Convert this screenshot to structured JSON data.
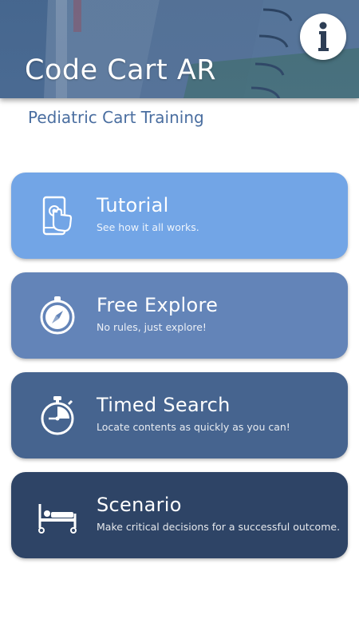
{
  "header": {
    "title": "Code Cart AR",
    "info_icon": "info-icon"
  },
  "subtitle": "Pediatric Cart Training",
  "menu": {
    "items": [
      {
        "label": "Tutorial",
        "description": "See how it all works.",
        "icon": "tablet-touch-icon",
        "color": "#72a5e6"
      },
      {
        "label": "Free Explore",
        "description": "No rules, just explore!",
        "icon": "compass-icon",
        "color": "#6384b8"
      },
      {
        "label": "Timed Search",
        "description": "Locate contents as quickly as you can!",
        "icon": "stopwatch-icon",
        "color": "#46648f"
      },
      {
        "label": "Scenario",
        "description": "Make critical decisions for a successful outcome.",
        "icon": "hospital-bed-icon",
        "color": "#2e4466"
      }
    ]
  },
  "colors": {
    "accent": "#4a6ea0",
    "header_bg": "#4d6d95"
  }
}
